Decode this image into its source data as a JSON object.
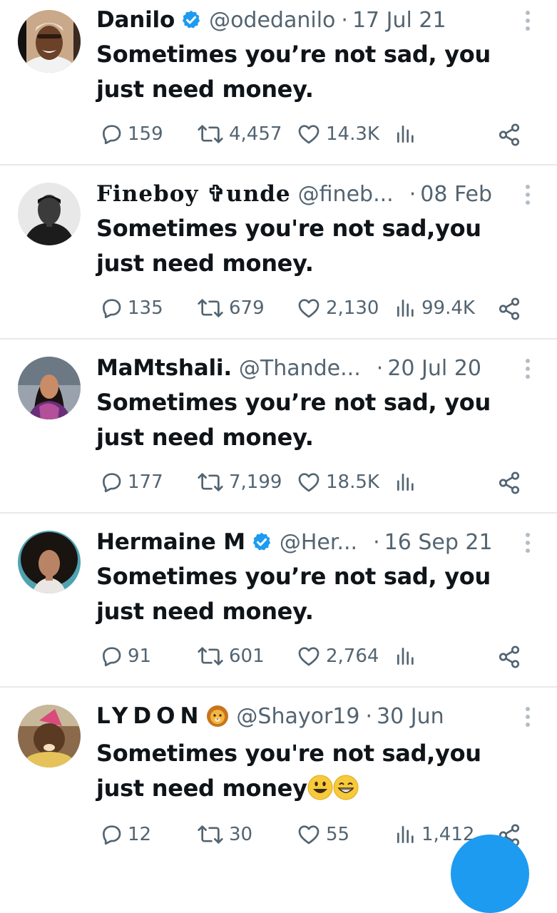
{
  "tweets": [
    {
      "name": "Danilo",
      "verified": true,
      "handle": "@odedanilo",
      "dot": "·",
      "date": "17 Jul 21",
      "text": "Sometimes you’re not sad, you just need money.",
      "replies": "159",
      "retweets": "4,457",
      "likes": "14.3K",
      "views": ""
    },
    {
      "name": "Fineboy ✞unde",
      "verified": false,
      "handle": "@fineb...",
      "dot": "·",
      "date": "08 Feb",
      "text": "Sometimes you're not sad,you just need money.",
      "replies": "135",
      "retweets": "679",
      "likes": "2,130",
      "views": "99.4K"
    },
    {
      "name": "MaMtshali.",
      "verified": false,
      "handle": "@Thande...",
      "dot": "·",
      "date": "20 Jul 20",
      "text": "Sometimes you’re not sad, you just need money.",
      "replies": "177",
      "retweets": "7,199",
      "likes": "18.5K",
      "views": ""
    },
    {
      "name": "Hermaine M",
      "verified": true,
      "handle": "@Her...",
      "dot": "·",
      "date": "16 Sep 21",
      "text": "Sometimes you’re not sad, you just need money.",
      "replies": "91",
      "retweets": "601",
      "likes": "2,764",
      "views": ""
    },
    {
      "name": "LYDON",
      "verified": false,
      "emoji": "lion-emoji-icon",
      "handle": "@Shayor19",
      "dot": "·",
      "date": "30 Jun",
      "text": "Sometimes you're not sad,you just need money",
      "text_emojis": [
        "smiley-face-emoji-icon",
        "grinning-face-emoji-icon"
      ],
      "replies": "12",
      "retweets": "30",
      "likes": "55",
      "views": "1,412"
    }
  ],
  "colors": {
    "text_primary": "#0f1419",
    "text_secondary": "#536471",
    "verified_blue": "#1d9bf0",
    "divider": "#e7e9eb"
  }
}
